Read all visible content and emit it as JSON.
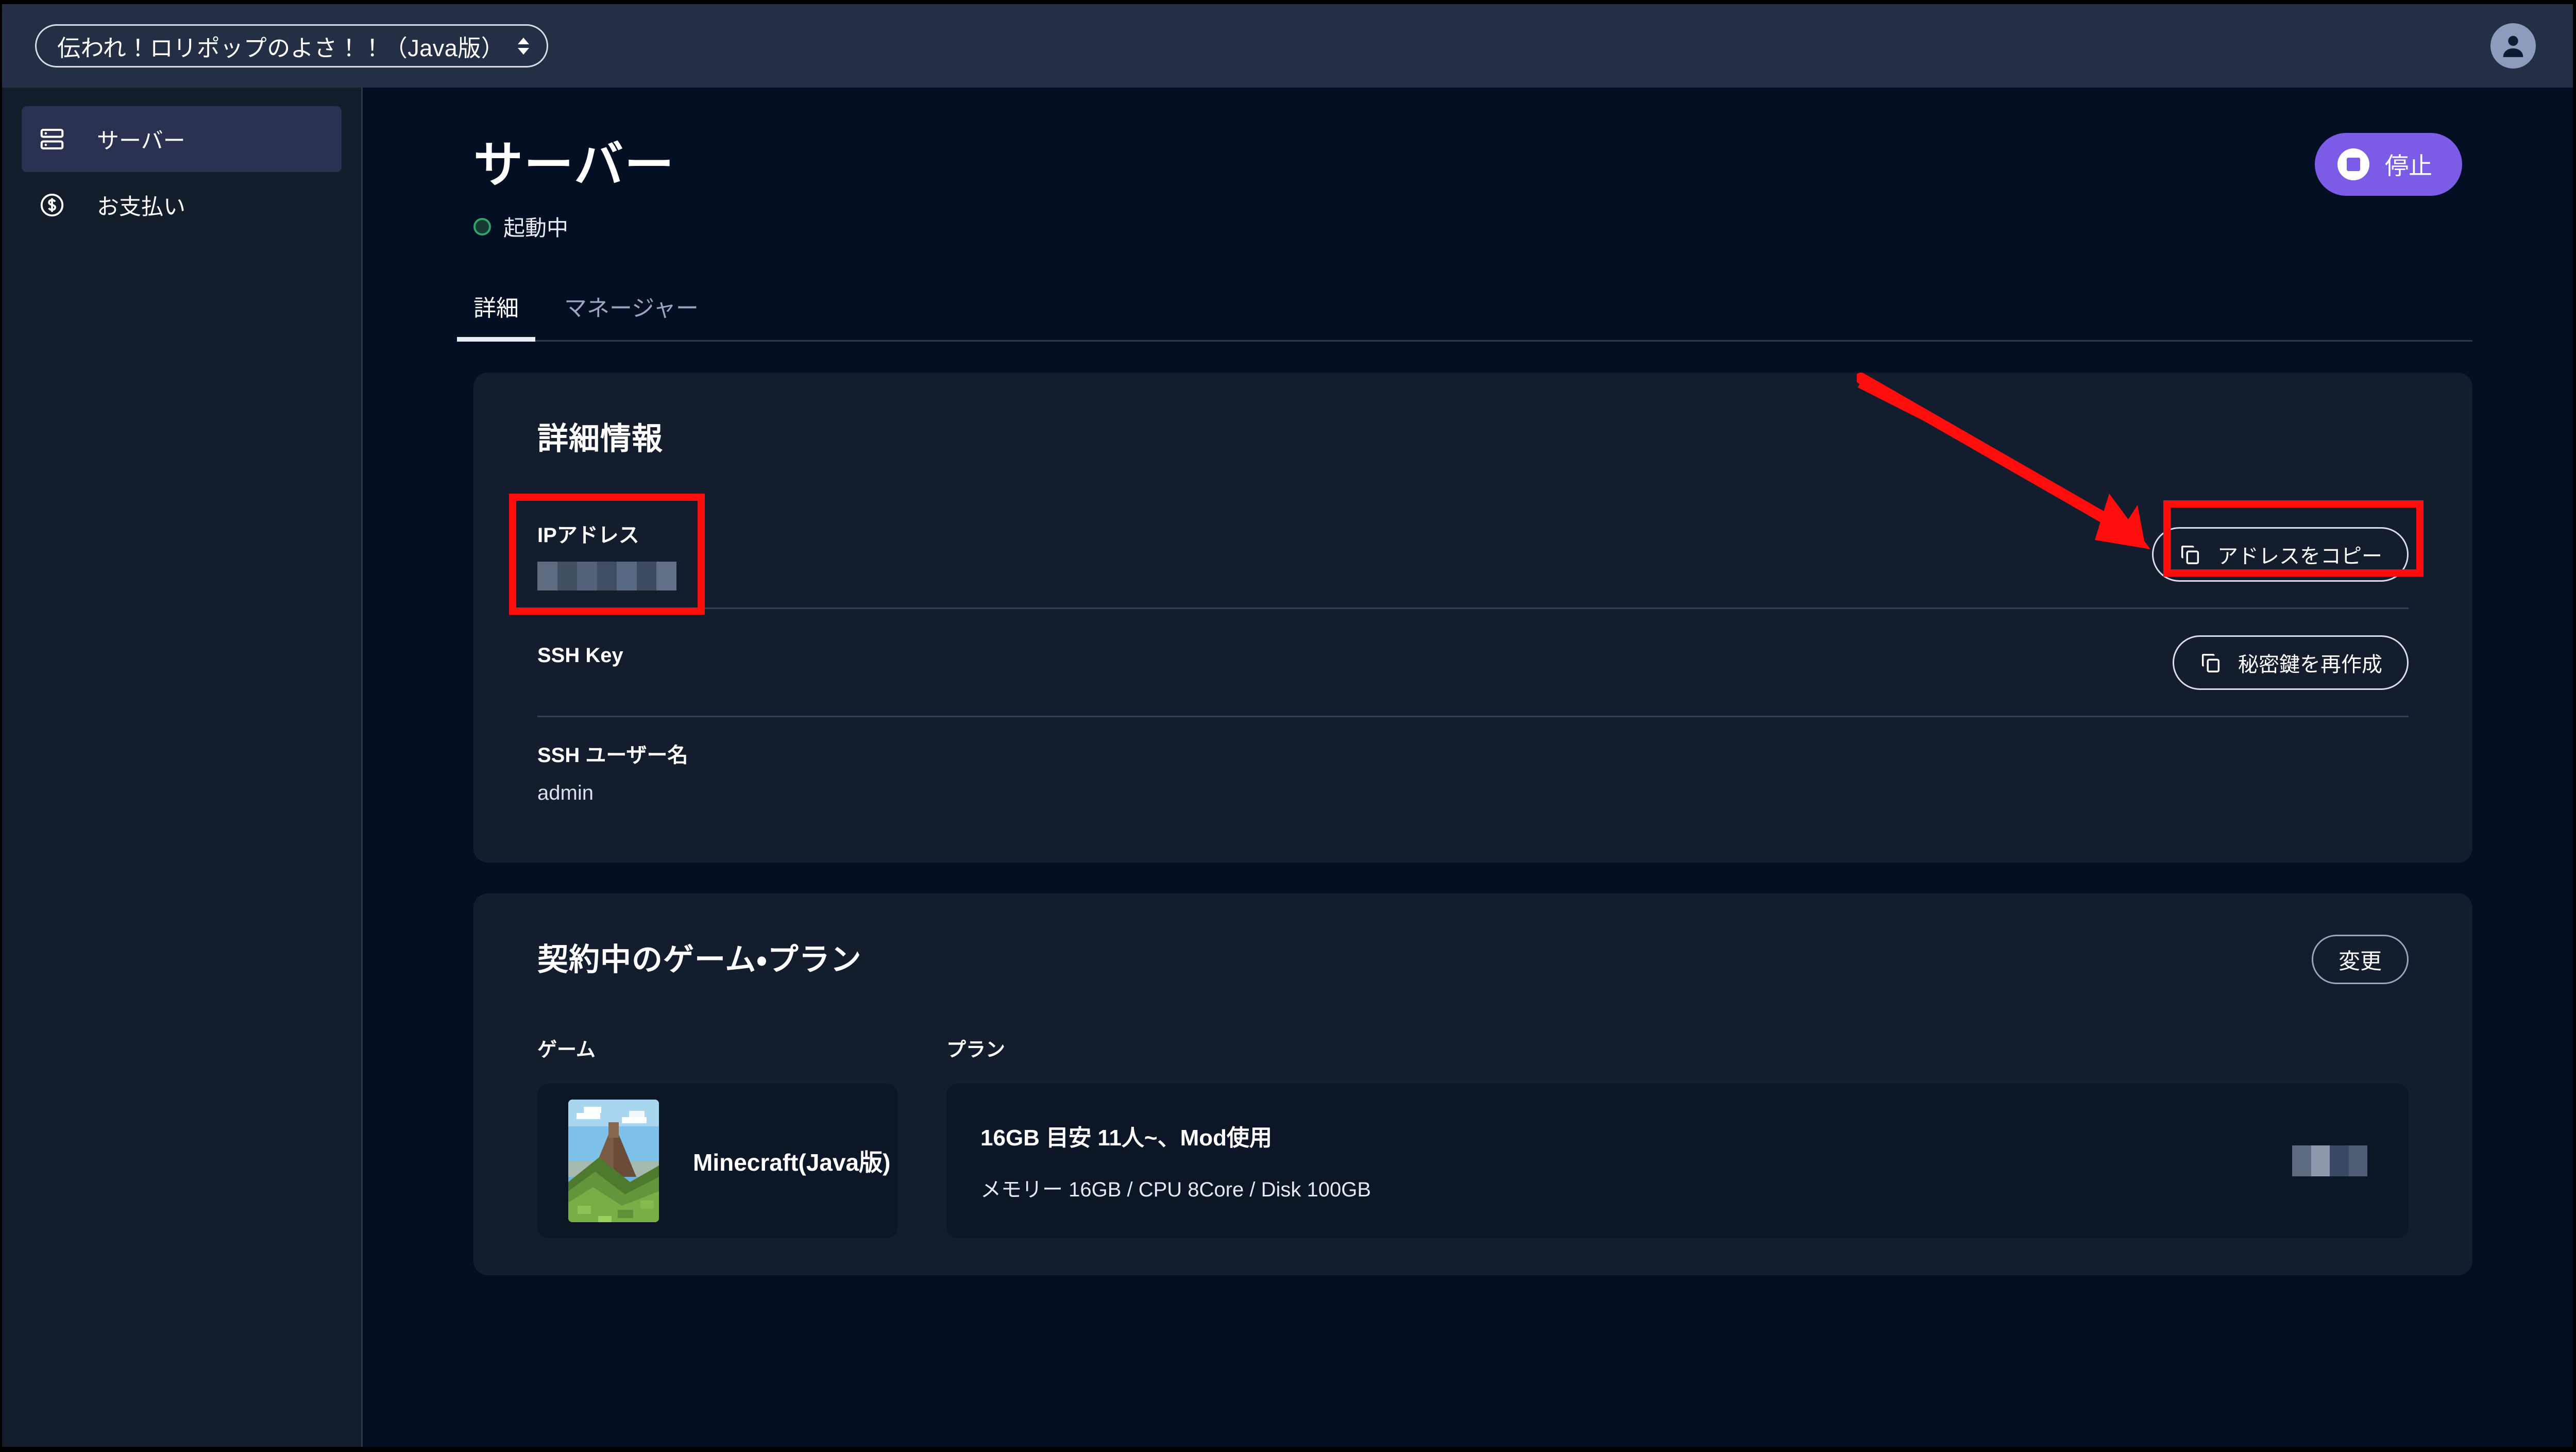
{
  "topbar": {
    "server_select_value": "伝われ！ロリポップのよさ！！（Java版）",
    "select_icon": "chevron-updown-icon",
    "avatar_icon": "user-avatar-icon"
  },
  "sidebar": {
    "items": [
      {
        "label": "サーバー",
        "icon": "server-icon",
        "active": true
      },
      {
        "label": "お支払い",
        "icon": "dollar-circle-icon",
        "active": false
      }
    ]
  },
  "page": {
    "title": "サーバー",
    "status_text": "起動中",
    "status_color": "#2ea36a",
    "stop_button": {
      "label": "停止",
      "icon": "stop-square-icon",
      "color": "#7b5ce6"
    },
    "tabs": [
      {
        "label": "詳細",
        "active": true
      },
      {
        "label": "マネージャー",
        "active": false
      }
    ]
  },
  "detail_card": {
    "title": "詳細情報",
    "rows": [
      {
        "label": "IPアドレス",
        "value": "",
        "value_redacted": true,
        "action": {
          "label": "アドレスをコピー",
          "icon": "copy-icon"
        }
      },
      {
        "label": "SSH Key",
        "value": "",
        "value_redacted": false,
        "action": {
          "label": "秘密鍵を再作成",
          "icon": "copy-icon"
        }
      },
      {
        "label": "SSH ユーザー名",
        "value": "admin",
        "value_redacted": false,
        "action": null
      }
    ]
  },
  "plan_card": {
    "title": "契約中のゲーム・プラン",
    "change_button": "変更",
    "game_column_label": "ゲーム",
    "plan_column_label": "プラン",
    "game": {
      "name": "Minecraft(Java版)",
      "thumbnail": "minecraft-landscape-thumbnail"
    },
    "plan": {
      "name": "16GB  目安 11人~、Mod使用",
      "specs": "メモリー 16GB / CPU 8Core / Disk 100GB",
      "price_redacted": true
    }
  },
  "annotations": {
    "color": "#ff0d0d",
    "shapes": [
      "ip-address-highlight-box",
      "copy-address-highlight-box",
      "pointer-arrow"
    ]
  }
}
